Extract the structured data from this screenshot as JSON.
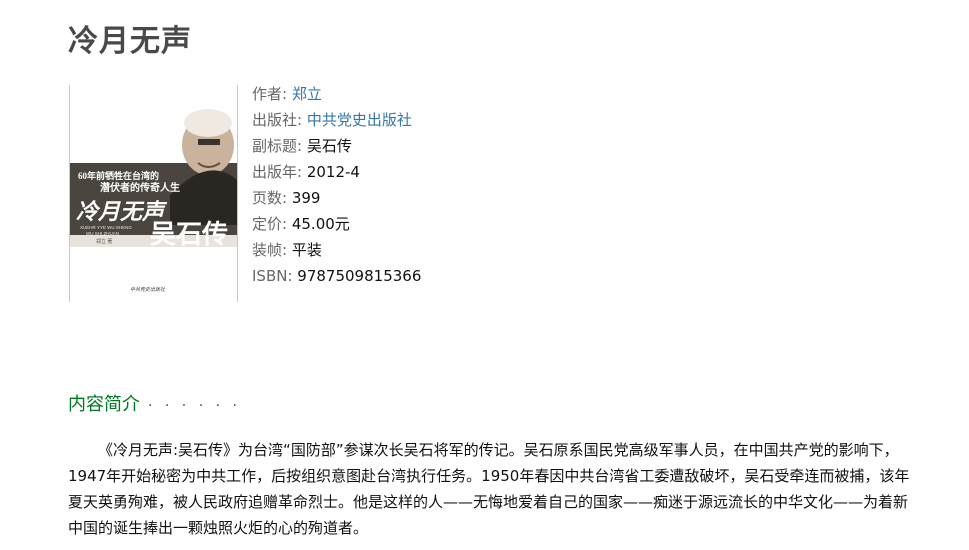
{
  "book": {
    "title": "冷月无声",
    "cover": {
      "top_line1": "60年前牺牲在台湾的",
      "top_line2": "潜伏者的传奇人生",
      "big_title": "冷月无声",
      "subtitle_large": "吴石传",
      "pinyin_line1": "XUEHR YYE WU SHENG",
      "pinyin_line2": "WU SHI ZHUAN",
      "author_line": "郑立 著",
      "publisher_line": "中共党史出版社",
      "colors": {
        "banner": "#4a453f",
        "text_light": "#ffffff",
        "text_dark": "#2b2b2b"
      }
    },
    "info": {
      "author": {
        "label": "作者:",
        "value": "郑立"
      },
      "publisher": {
        "label": "出版社:",
        "value": "中共党史出版社"
      },
      "subtitle": {
        "label": "副标题:",
        "value": "吴石传"
      },
      "year": {
        "label": "出版年:",
        "value": "2012-4"
      },
      "pages": {
        "label": "页数:",
        "value": "399"
      },
      "price": {
        "label": "定价:",
        "value": "45.00元"
      },
      "binding": {
        "label": "装帧:",
        "value": "平装"
      },
      "isbn": {
        "label": "ISBN:",
        "value": "9787509815366"
      }
    }
  },
  "intro": {
    "heading": "内容简介",
    "dots": "· · · · · ·",
    "text": "《冷月无声:吴石传》为台湾“国防部”参谋次长吴石将军的传记。吴石原系国民党高级军事人员，在中国共产党的影响下，1947年开始秘密为中共工作，后按组织意图赴台湾执行任务。1950年春因中共台湾省工委遭敌破坏，吴石受牵连而被捕，该年夏天英勇殉难，被人民政府追赠革命烈士。他是这样的人——无悔地爱着自己的国家——痴迷于源远流长的中华文化——为着新中国的诞生捧出一颗烛照火炬的心的殉道者。"
  },
  "colors": {
    "title": "#494949",
    "link": "#37a",
    "label": "#666666",
    "section_heading": "#007722"
  }
}
